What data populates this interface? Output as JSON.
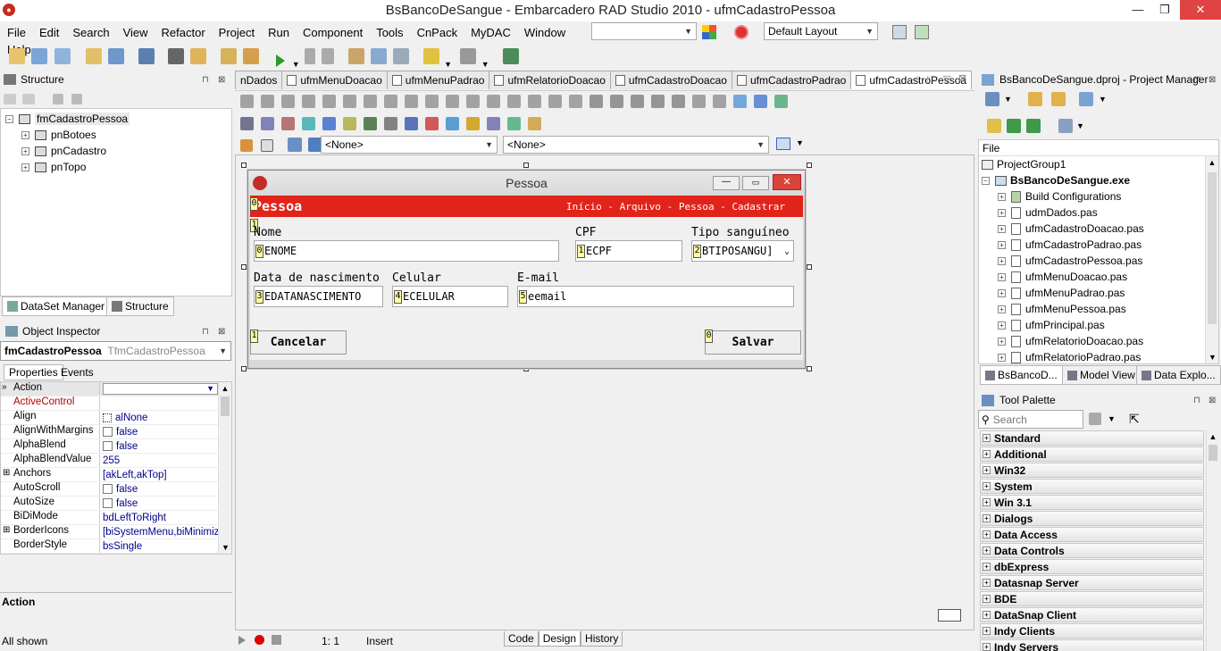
{
  "window": {
    "title": "BsBancoDeSangue - Embarcadero RAD Studio 2010 - ufmCadastroPessoa",
    "min": "—",
    "max": "❐",
    "close": "✕"
  },
  "menu": [
    "File",
    "Edit",
    "Search",
    "View",
    "Refactor",
    "Project",
    "Run",
    "Component",
    "Tools",
    "CnPack",
    "MyDAC",
    "Window",
    "Help"
  ],
  "toolbar": {
    "combo_empty": "",
    "layout": "Default Layout"
  },
  "structure": {
    "title": "Structure",
    "root": "fmCadastroPessoa",
    "children": [
      "pnBotoes",
      "pnCadastro",
      "pnTopo"
    ],
    "tab_dataset": "DataSet Manager",
    "tab_structure": "Structure"
  },
  "object_inspector": {
    "title": "Object Inspector",
    "obj_name": "fmCadastroPessoa",
    "obj_type": "TfmCadastroPessoa",
    "tab_props": "Properties",
    "tab_events": "Events",
    "rows": [
      {
        "k": "Action",
        "v": "",
        "cls": "hdr"
      },
      {
        "k": "ActiveControl",
        "v": "",
        "cls": "red"
      },
      {
        "k": "Align",
        "v": "alNone",
        "cls": "icon"
      },
      {
        "k": "AlignWithMargins",
        "v": "false",
        "cls": "chk"
      },
      {
        "k": "AlphaBlend",
        "v": "false",
        "cls": "chk"
      },
      {
        "k": "AlphaBlendValue",
        "v": "255",
        "cls": ""
      },
      {
        "k": "Anchors",
        "v": "[akLeft,akTop]",
        "cls": "exp"
      },
      {
        "k": "AutoScroll",
        "v": "false",
        "cls": "chk"
      },
      {
        "k": "AutoSize",
        "v": "false",
        "cls": "chk"
      },
      {
        "k": "BiDiMode",
        "v": "bdLeftToRight",
        "cls": ""
      },
      {
        "k": "BorderIcons",
        "v": "[biSystemMenu,biMinimize]",
        "cls": "exp"
      },
      {
        "k": "BorderStyle",
        "v": "bsSingle",
        "cls": ""
      }
    ],
    "desc_title": "Action",
    "status": "All shown"
  },
  "editor_tabs": [
    "nDados",
    "ufmMenuDoacao",
    "ufmMenuPadrao",
    "ufmRelatorioDoacao",
    "ufmCadastroDoacao",
    "ufmCadastroPadrao",
    "ufmCadastroPessoa"
  ],
  "designer": {
    "combo1": "<None>",
    "combo2": "<None>",
    "form_caption": "Pessoa",
    "banner_title": "Pessoa",
    "banner_nav": "Início - Arquivo - Pessoa - Cadastrar",
    "labels": {
      "nome": "Nome",
      "cpf": "CPF",
      "tipo": "Tipo sanguíneo",
      "data": "Data de nascimento",
      "celular": "Celular",
      "email": "E-mail"
    },
    "fields": {
      "nome": "ENOME",
      "cpf": "ECPF",
      "tipo": "BTIPOSANGU]",
      "data": "EDATANASCIMENTO",
      "celular": "ECELULAR",
      "email": "eemail"
    },
    "orders": {
      "nome": "0",
      "cpf": "1",
      "tipo": "2",
      "data": "3",
      "celular": "4",
      "email": "5",
      "cancel": "1",
      "save": "0",
      "banner": "0",
      "banner2": "1"
    },
    "cancel": "Cancelar",
    "save": "Salvar"
  },
  "statusbar": {
    "pos": "1:  1",
    "mode": "Insert",
    "tabs": [
      "Code",
      "Design",
      "History"
    ]
  },
  "project_manager": {
    "title": "BsBancoDeSangue.dproj - Project Manager",
    "header": "File",
    "group": "ProjectGroup1",
    "exe": "BsBancoDeSangue.exe",
    "items": [
      "Build Configurations",
      "udmDados.pas",
      "ufmCadastroDoacao.pas",
      "ufmCadastroPadrao.pas",
      "ufmCadastroPessoa.pas",
      "ufmMenuDoacao.pas",
      "ufmMenuPadrao.pas",
      "ufmMenuPessoa.pas",
      "ufmPrincipal.pas",
      "ufmRelatorioDoacao.pas",
      "ufmRelatorioPadrao.pas"
    ],
    "tabs": [
      "BsBancoD...",
      "Model View",
      "Data Explo..."
    ]
  },
  "tool_palette": {
    "title": "Tool Palette",
    "search_placeholder": "Search",
    "categories": [
      "Standard",
      "Additional",
      "Win32",
      "System",
      "Win 3.1",
      "Dialogs",
      "Data Access",
      "Data Controls",
      "dbExpress",
      "Datasnap Server",
      "BDE",
      "DataSnap Client",
      "Indy Clients",
      "Indy Servers"
    ]
  },
  "colors": {
    "banner": "#e2231a",
    "form_close": "#d9443a",
    "title_close": "#e04343"
  }
}
